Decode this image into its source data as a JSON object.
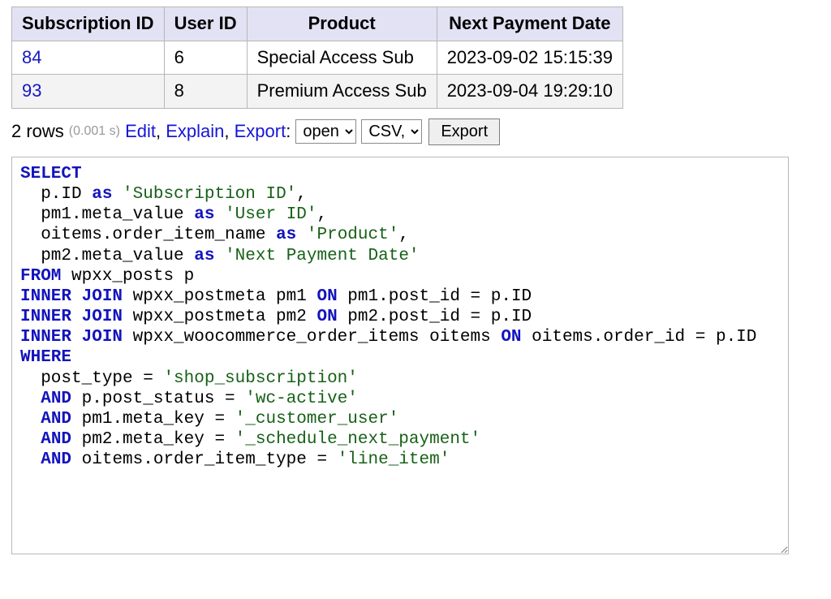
{
  "table": {
    "headers": [
      "Subscription ID",
      "User ID",
      "Product",
      "Next Payment Date"
    ],
    "rows": [
      {
        "subscription_id": "84",
        "user_id": "6",
        "product": "Special Access Sub",
        "next_payment": "2023-09-02 15:15:39"
      },
      {
        "subscription_id": "93",
        "user_id": "8",
        "product": "Premium Access Sub",
        "next_payment": "2023-09-04 19:29:10"
      }
    ]
  },
  "status": {
    "rows_label": "2 rows",
    "timing": "(0.001 s)",
    "edit": "Edit",
    "explain": "Explain",
    "export_link": "Export",
    "export_colon": ":",
    "select_how_value": "open",
    "select_how_options": [
      "open"
    ],
    "select_fmt_value": "CSV,",
    "select_fmt_options": [
      "CSV,"
    ],
    "export_button": "Export"
  },
  "sql": {
    "l1": "SELECT",
    "l2_a": "  p.ID ",
    "l2_kw": "as",
    "l2_b": " ",
    "l2_s": "'Subscription ID'",
    "l2_c": ",",
    "l3_a": "  pm1.meta_value ",
    "l3_kw": "as",
    "l3_b": " ",
    "l3_s": "'User ID'",
    "l3_c": ",",
    "l4_a": "  oitems.order_item_name ",
    "l4_kw": "as",
    "l4_b": " ",
    "l4_s": "'Product'",
    "l4_c": ",",
    "l5_a": "  pm2.meta_value ",
    "l5_kw": "as",
    "l5_b": " ",
    "l5_s": "'Next Payment Date'",
    "l6_kw": "FROM",
    "l6_b": " wpxx_posts p",
    "l7_kw1": "INNER JOIN",
    "l7_a": " wpxx_postmeta pm1 ",
    "l7_kw2": "ON",
    "l7_b": " pm1.post_id = p.ID",
    "l8_kw1": "INNER JOIN",
    "l8_a": " wpxx_postmeta pm2 ",
    "l8_kw2": "ON",
    "l8_b": " pm2.post_id = p.ID",
    "l9_kw1": "INNER JOIN",
    "l9_a": " wpxx_woocommerce_order_items oitems ",
    "l9_kw2": "ON",
    "l9_b": " oitems.order_id = p.ID",
    "l10_kw": "WHERE",
    "l11_a": "  post_type = ",
    "l11_s": "'shop_subscription'",
    "l12_kw": "AND",
    "l12_a": " p.post_status = ",
    "l12_s": "'wc-active'",
    "l13_kw": "AND",
    "l13_a": " pm1.meta_key = ",
    "l13_s": "'_customer_user'",
    "l14_kw": "AND",
    "l14_a": " pm2.meta_key = ",
    "l14_s": "'_schedule_next_payment'",
    "l15_kw": "AND",
    "l15_a": " oitems.order_item_type = ",
    "l15_s": "'line_item'"
  }
}
